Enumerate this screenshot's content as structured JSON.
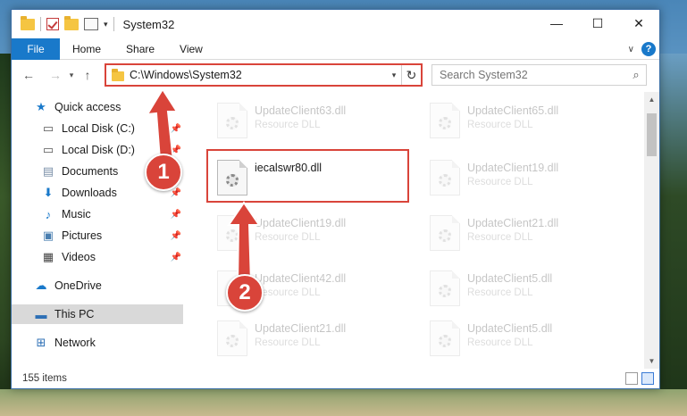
{
  "window": {
    "title": "System32",
    "controls": {
      "minimize": "—",
      "maximize": "☐",
      "close": "✕"
    }
  },
  "ribbon": {
    "file_tab": "File",
    "tabs": [
      "Home",
      "Share",
      "View"
    ],
    "help": "?"
  },
  "nav": {
    "back": "←",
    "forward": "→",
    "recent": "▾",
    "up": "↑"
  },
  "address": {
    "path": "C:\\Windows\\System32"
  },
  "search": {
    "placeholder": "Search System32"
  },
  "sidebar": {
    "items": [
      {
        "label": "Quick access",
        "icon": "star-icon",
        "pinned": false
      },
      {
        "label": "Local Disk (C:)",
        "icon": "drive-icon",
        "pinned": true
      },
      {
        "label": "Local Disk (D:)",
        "icon": "drive-icon",
        "pinned": true
      },
      {
        "label": "Documents",
        "icon": "documents-icon",
        "pinned": true
      },
      {
        "label": "Downloads",
        "icon": "download-icon",
        "pinned": true
      },
      {
        "label": "Music",
        "icon": "music-icon",
        "pinned": true
      },
      {
        "label": "Pictures",
        "icon": "pictures-icon",
        "pinned": true
      },
      {
        "label": "Videos",
        "icon": "videos-icon",
        "pinned": true
      },
      {
        "label": "OneDrive",
        "icon": "cloud-icon",
        "pinned": false
      },
      {
        "label": "This PC",
        "icon": "computer-icon",
        "pinned": false,
        "selected": true
      },
      {
        "label": "Network",
        "icon": "network-icon",
        "pinned": false
      }
    ]
  },
  "files": [
    {
      "name": "UpdateClient63.dll",
      "type": "Resource DLL",
      "faded": true
    },
    {
      "name": "UpdateClient65.dll",
      "type": "Resource DLL",
      "faded": true
    },
    {
      "name": "iecalswr80.dll",
      "type": "",
      "faded": false,
      "highlighted": true
    },
    {
      "name": "UpdateClient19.dll",
      "type": "Resource DLL",
      "faded": true
    },
    {
      "name": "UpdateClient19.dll",
      "type": "Resource DLL",
      "faded": true
    },
    {
      "name": "UpdateClient21.dll",
      "type": "Resource DLL",
      "faded": true
    },
    {
      "name": "UpdateClient42.dll",
      "type": "Resource DLL",
      "faded": true
    },
    {
      "name": "UpdateClient5.dll",
      "type": "Resource DLL",
      "faded": true
    },
    {
      "name": "UpdateClient21.dll",
      "type": "Resource DLL",
      "faded": true
    },
    {
      "name": "UpdateClient5.dll",
      "type": "Resource DLL",
      "faded": true
    }
  ],
  "status": {
    "item_count": "155 items"
  },
  "callouts": {
    "step1": "1",
    "step2": "2"
  },
  "colors": {
    "accent": "#1979ca",
    "annotation": "#d9443a"
  }
}
